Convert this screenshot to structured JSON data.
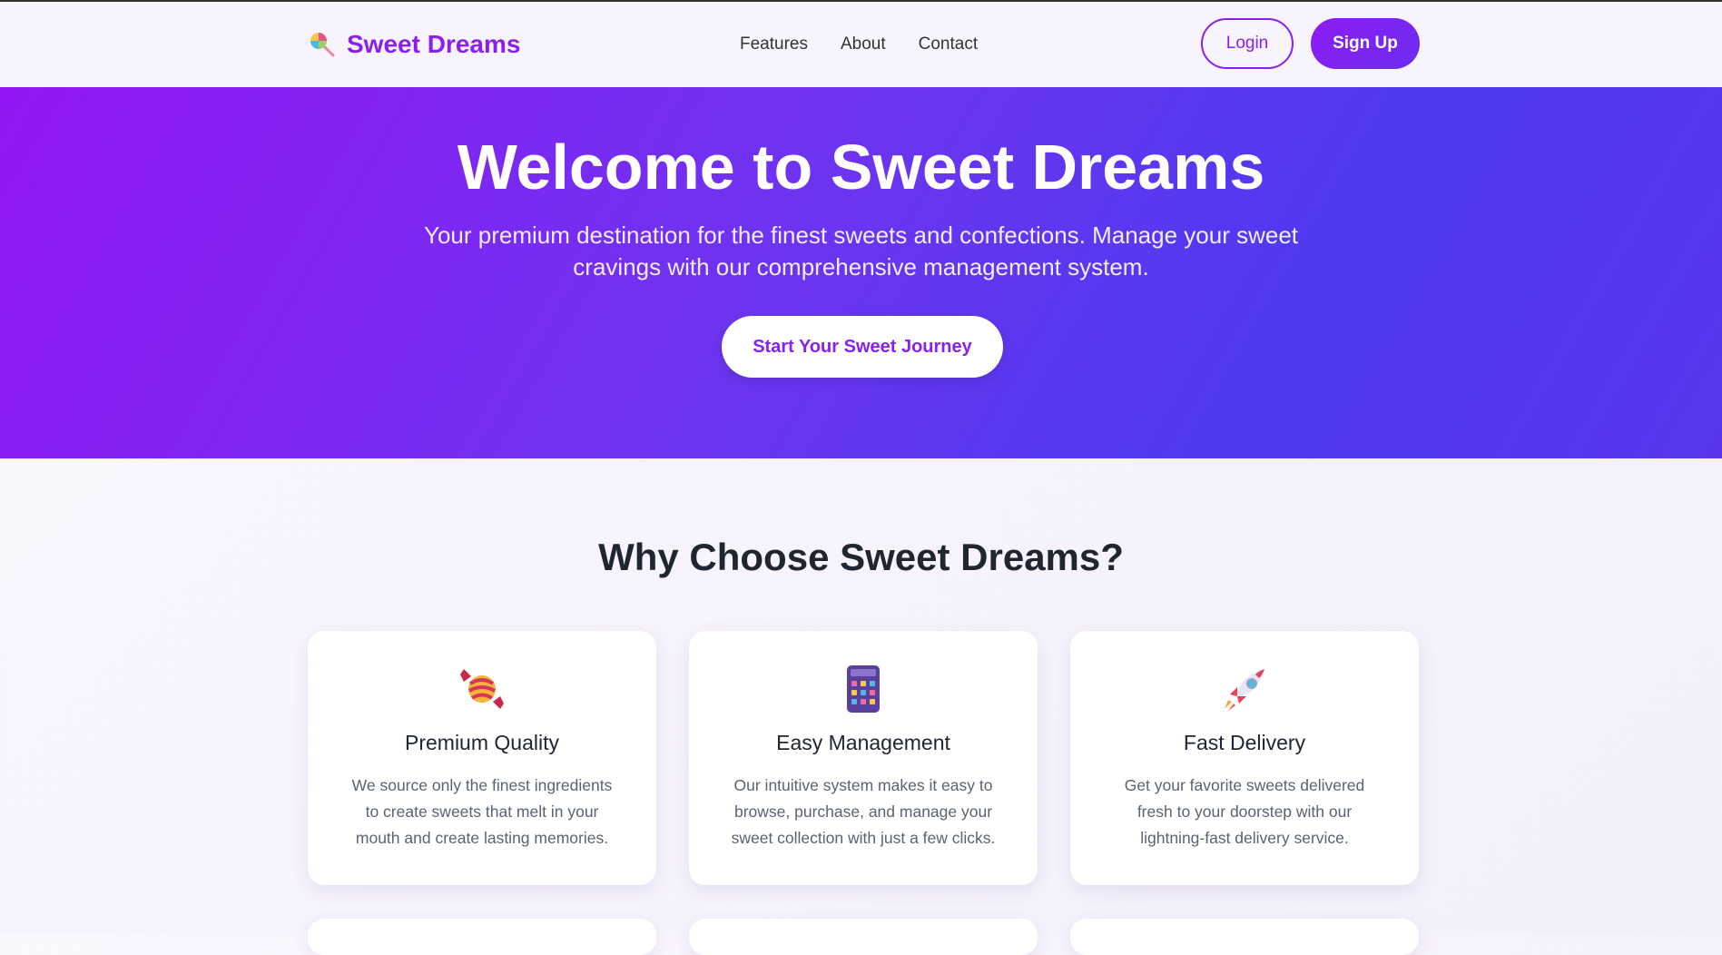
{
  "header": {
    "brand": "Sweet Dreams",
    "brand_icon": "lollipop-icon",
    "nav": [
      {
        "label": "Features"
      },
      {
        "label": "About"
      },
      {
        "label": "Contact"
      }
    ],
    "login_label": "Login",
    "signup_label": "Sign Up"
  },
  "hero": {
    "title": "Welcome to Sweet Dreams",
    "subtitle": "Your premium destination for the finest sweets and confections. Manage your sweet cravings with our comprehensive management system.",
    "cta_label": "Start Your Sweet Journey"
  },
  "features": {
    "title": "Why Choose Sweet Dreams?",
    "cards": [
      {
        "icon": "candy-icon",
        "title": "Premium Quality",
        "text": "We source only the finest ingredients to create sweets that melt in your mouth and create lasting memories."
      },
      {
        "icon": "calculator-icon",
        "title": "Easy Management",
        "text": "Our intuitive system makes it easy to browse, purchase, and manage your sweet collection with just a few clicks."
      },
      {
        "icon": "rocket-icon",
        "title": "Fast Delivery",
        "text": "Get your favorite sweets delivered fresh to your doorstep with our lightning-fast delivery service."
      }
    ]
  },
  "colors": {
    "brand": "#8a1ff0",
    "hero_start": "#9316f5",
    "hero_end": "#4d3af1",
    "heading": "#1f2531"
  }
}
